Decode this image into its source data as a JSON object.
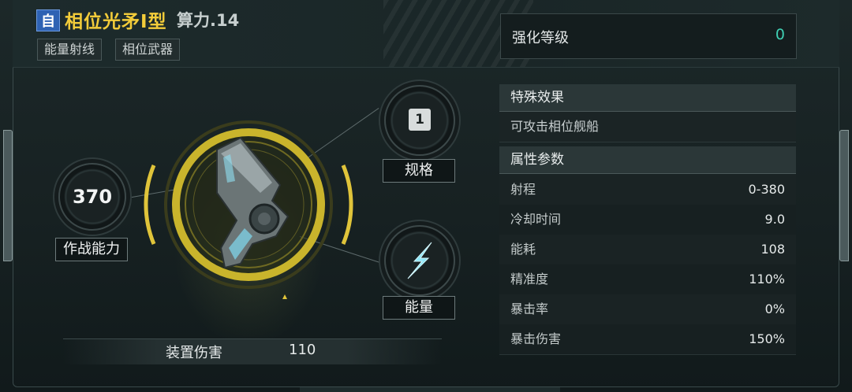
{
  "header": {
    "self_badge": "自",
    "weapon_name": "相位光矛I型",
    "power_label": "算力.14",
    "tags": [
      "能量射线",
      "相位武器"
    ]
  },
  "enhance": {
    "label": "强化等级",
    "value": "0",
    "value_color": "#3fcfb3"
  },
  "special": {
    "title": "特殊效果",
    "effect": "可攻击相位舰船"
  },
  "attributes": {
    "title": "属性参数",
    "rows": [
      {
        "label": "射程",
        "value": "0-380"
      },
      {
        "label": "冷却时间",
        "value": "9.0"
      },
      {
        "label": "能耗",
        "value": "108"
      },
      {
        "label": "精准度",
        "value": "110%"
      },
      {
        "label": "暴击率",
        "value": "0%"
      },
      {
        "label": "暴击伤害",
        "value": "150%"
      }
    ]
  },
  "combat": {
    "value": "370",
    "label": "作战能力"
  },
  "spec": {
    "value": "1",
    "label": "规格"
  },
  "energy": {
    "label": "能量",
    "icon": "energy-bolt-icon"
  },
  "damage": {
    "label": "装置伤害",
    "value": "110"
  },
  "colors": {
    "accent_gold": "#f3cc3a",
    "ring_gold": "#c9b42c",
    "teal": "#3fcfb3"
  }
}
